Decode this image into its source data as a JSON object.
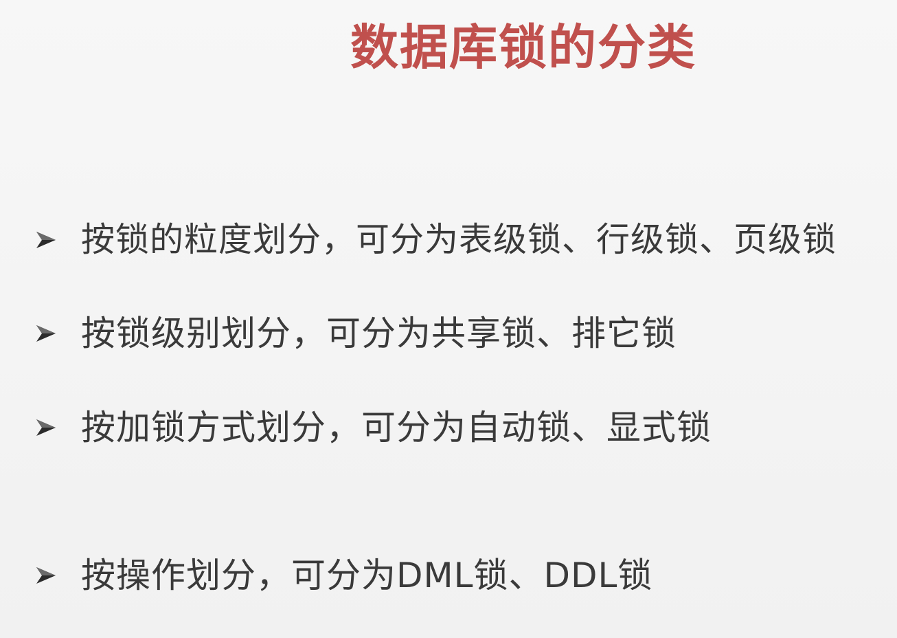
{
  "slide": {
    "title": "数据库锁的分类",
    "title_color": "#c0504d",
    "bullet_icon": "arrow-bullet-icon",
    "bullets": [
      {
        "text": "按锁的粒度划分，可分为表级锁、行级锁、页级锁"
      },
      {
        "text": "按锁级别划分，可分为共享锁、排它锁"
      },
      {
        "text": "按加锁方式划分，可分为自动锁、显式锁"
      },
      {
        "text": "按操作划分，可分为DML锁、DDL锁"
      }
    ]
  }
}
